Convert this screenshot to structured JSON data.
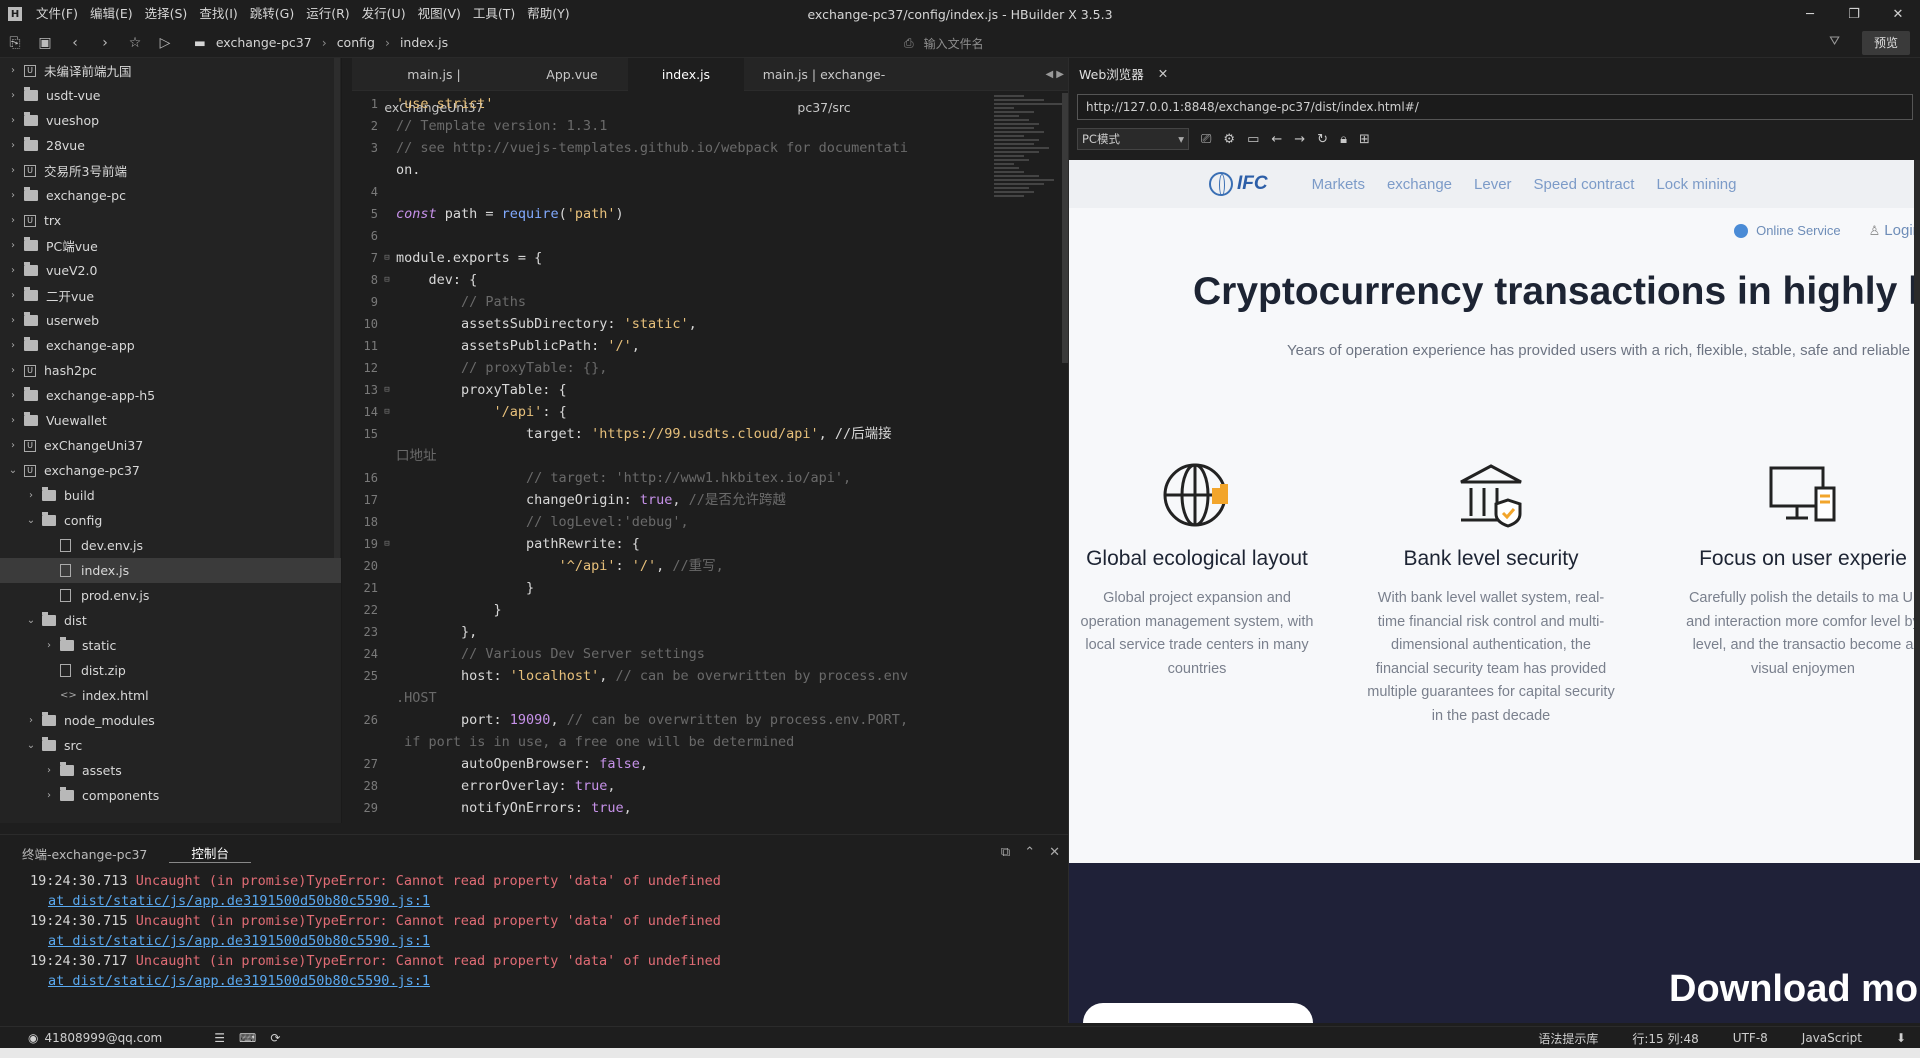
{
  "window": {
    "title": "exchange-pc37/config/index.js - HBuilder X 3.5.3",
    "menu": [
      "文件(F)",
      "编辑(E)",
      "选择(S)",
      "查找(I)",
      "跳转(G)",
      "运行(R)",
      "发行(U)",
      "视图(V)",
      "工具(T)",
      "帮助(Y)"
    ],
    "controls": {
      "minimize": "─",
      "restore": "❐",
      "close": "✕"
    }
  },
  "toolbar": {
    "breadcrumb": [
      "exchange-pc37",
      "config",
      "index.js"
    ],
    "file_search_placeholder": "输入文件名",
    "preview_label": "预览"
  },
  "sidebar": {
    "items": [
      {
        "label": "未编译前端九国",
        "type": "project",
        "expanded": false
      },
      {
        "label": "usdt-vue",
        "type": "folder",
        "expanded": false
      },
      {
        "label": "vueshop",
        "type": "folder",
        "expanded": false
      },
      {
        "label": "28vue",
        "type": "folder",
        "expanded": false
      },
      {
        "label": "交易所3号前端",
        "type": "project",
        "expanded": false
      },
      {
        "label": "exchange-pc",
        "type": "folder",
        "expanded": false
      },
      {
        "label": "trx",
        "type": "project",
        "expanded": false
      },
      {
        "label": "PC端vue",
        "type": "folder",
        "expanded": false
      },
      {
        "label": "vueV2.0",
        "type": "folder",
        "expanded": false
      },
      {
        "label": "二开vue",
        "type": "folder",
        "expanded": false
      },
      {
        "label": "userweb",
        "type": "folder",
        "expanded": false
      },
      {
        "label": "exchange-app",
        "type": "folder",
        "expanded": false
      },
      {
        "label": "hash2pc",
        "type": "project",
        "expanded": false
      },
      {
        "label": "exchange-app-h5",
        "type": "folder",
        "expanded": false
      },
      {
        "label": "Vuewallet",
        "type": "folder",
        "expanded": false
      },
      {
        "label": "exChangeUni37",
        "type": "project",
        "expanded": false
      },
      {
        "label": "exchange-pc37",
        "type": "project",
        "expanded": true
      },
      {
        "label": "build",
        "type": "folder",
        "depth": 1,
        "expanded": false
      },
      {
        "label": "config",
        "type": "folder",
        "depth": 1,
        "expanded": true
      },
      {
        "label": "dev.env.js",
        "type": "file",
        "depth": 2
      },
      {
        "label": "index.js",
        "type": "file",
        "depth": 2,
        "selected": true
      },
      {
        "label": "prod.env.js",
        "type": "file",
        "depth": 2
      },
      {
        "label": "dist",
        "type": "folder",
        "depth": 1,
        "expanded": true
      },
      {
        "label": "static",
        "type": "folder",
        "depth": 2,
        "expanded": false
      },
      {
        "label": "dist.zip",
        "type": "file",
        "depth": 2
      },
      {
        "label": "index.html",
        "type": "html",
        "depth": 2
      },
      {
        "label": "node_modules",
        "type": "folder",
        "depth": 1,
        "expanded": false
      },
      {
        "label": "src",
        "type": "folder",
        "depth": 1,
        "expanded": true
      },
      {
        "label": "assets",
        "type": "folder",
        "depth": 2,
        "expanded": false
      },
      {
        "label": "components",
        "type": "folder",
        "depth": 2,
        "expanded": false
      }
    ]
  },
  "editor": {
    "tabs": [
      {
        "label": "main.js | exChangeUni37",
        "active": false
      },
      {
        "label": "App.vue",
        "active": false
      },
      {
        "label": "index.js",
        "active": true
      },
      {
        "label": "main.js | exchange-pc37/src",
        "active": false
      }
    ],
    "lines": [
      {
        "n": "1",
        "fold": "",
        "code": "'use strict'"
      },
      {
        "n": "2",
        "fold": "",
        "code": "// Template version: 1.3.1"
      },
      {
        "n": "3",
        "fold": "",
        "code": "// see http://vuejs-templates.github.io/webpack for documentati"
      },
      {
        "n": "",
        "fold": "",
        "code": "on."
      },
      {
        "n": "4",
        "fold": "",
        "code": ""
      },
      {
        "n": "5",
        "fold": "",
        "code": "const path = require('path')"
      },
      {
        "n": "6",
        "fold": "",
        "code": ""
      },
      {
        "n": "7",
        "fold": "⊟",
        "code": "module.exports = {"
      },
      {
        "n": "8",
        "fold": "⊟",
        "code": "    dev: {"
      },
      {
        "n": "9",
        "fold": "",
        "code": "        // Paths"
      },
      {
        "n": "10",
        "fold": "",
        "code": "        assetsSubDirectory: 'static',"
      },
      {
        "n": "11",
        "fold": "",
        "code": "        assetsPublicPath: '/',"
      },
      {
        "n": "12",
        "fold": "",
        "code": "        // proxyTable: {},"
      },
      {
        "n": "13",
        "fold": "⊟",
        "code": "        proxyTable: {"
      },
      {
        "n": "14",
        "fold": "⊟",
        "code": "            '/api': {"
      },
      {
        "n": "15",
        "fold": "",
        "code": "                target: 'https://99.usdts.cloud/api', //后端接"
      },
      {
        "n": "",
        "fold": "",
        "code": "口地址"
      },
      {
        "n": "16",
        "fold": "",
        "code": "                // target: 'http://www1.hkbitex.io/api',"
      },
      {
        "n": "17",
        "fold": "",
        "code": "                changeOrigin: true, //是否允许跨越"
      },
      {
        "n": "18",
        "fold": "",
        "code": "                // logLevel:'debug',"
      },
      {
        "n": "19",
        "fold": "⊟",
        "code": "                pathRewrite: {"
      },
      {
        "n": "20",
        "fold": "",
        "code": "                    '^/api': '/', //重写,"
      },
      {
        "n": "21",
        "fold": "",
        "code": "                }"
      },
      {
        "n": "22",
        "fold": "",
        "code": "            }"
      },
      {
        "n": "23",
        "fold": "",
        "code": "        },"
      },
      {
        "n": "24",
        "fold": "",
        "code": "        // Various Dev Server settings"
      },
      {
        "n": "25",
        "fold": "",
        "code": "        host: 'localhost', // can be overwritten by process.env"
      },
      {
        "n": "",
        "fold": "",
        "code": ".HOST"
      },
      {
        "n": "26",
        "fold": "",
        "code": "        port: 19090, // can be overwritten by process.env.PORT,"
      },
      {
        "n": "",
        "fold": "",
        "code": " if port is in use, a free one will be determined"
      },
      {
        "n": "27",
        "fold": "",
        "code": "        autoOpenBrowser: false,"
      },
      {
        "n": "28",
        "fold": "",
        "code": "        errorOverlay: true,"
      },
      {
        "n": "29",
        "fold": "",
        "code": "        notifyOnErrors: true,"
      }
    ]
  },
  "console": {
    "tabs": [
      {
        "label": "终端-exchange-pc37",
        "active": false
      },
      {
        "label": "控制台",
        "active": true
      }
    ],
    "entries": [
      {
        "time": "19:24:30.713",
        "message": "Uncaught (in promise)TypeError: Cannot read property 'data' of undefined",
        "link": "at dist/static/js/app.de3191500d50b80c5590.js:1"
      },
      {
        "time": "19:24:30.715",
        "message": "Uncaught (in promise)TypeError: Cannot read property 'data' of undefined",
        "link": "at dist/static/js/app.de3191500d50b80c5590.js:1"
      },
      {
        "time": "19:24:30.717",
        "message": "Uncaught (in promise)TypeError: Cannot read property 'data' of undefined",
        "link": "at dist/static/js/app.de3191500d50b80c5590.js:1"
      }
    ]
  },
  "browser": {
    "tab_label": "Web浏览器",
    "url": "http://127.0.0.1:8848/exchange-pc37/dist/index.html#/",
    "mode": "PC模式",
    "site": {
      "logo": "IFC",
      "nav": [
        "Markets",
        "exchange",
        "Lever",
        "Speed contract",
        "Lock mining"
      ],
      "online_service": "Online Service",
      "login": "Login",
      "hero_title": "Cryptocurrency transactions in highly lic",
      "hero_sub": "Years of operation experience has provided users with a rich, flexible, stable, safe and reliable",
      "features": [
        {
          "icon": "globe-icon",
          "title": "Global ecological layout",
          "desc": "Global project expansion and operation management system, with local service trade centers in many countries"
        },
        {
          "icon": "bank-icon",
          "title": "Bank level security",
          "desc": "With bank level wallet system, real-time financial risk control and multi-dimensional authentication, the financial security team has provided multiple guarantees for capital security in the past decade"
        },
        {
          "icon": "monitor-icon",
          "title": "Focus on user experie",
          "desc": "Carefully polish the details to ma UI and interaction more comfor level by level, and the transactio become a visual enjoymen"
        }
      ],
      "download": "Download mo"
    }
  },
  "statusbar": {
    "account": "41808999@qq.com",
    "hint": "语法提示库",
    "position": "行:15  列:48",
    "encoding": "UTF-8",
    "language": "JavaScript"
  },
  "colors": {
    "accent_blue": "#5aa9f0",
    "error_red": "#e06c75",
    "site_nav": "#7c9bc8",
    "dark_band": "#1f2138"
  }
}
